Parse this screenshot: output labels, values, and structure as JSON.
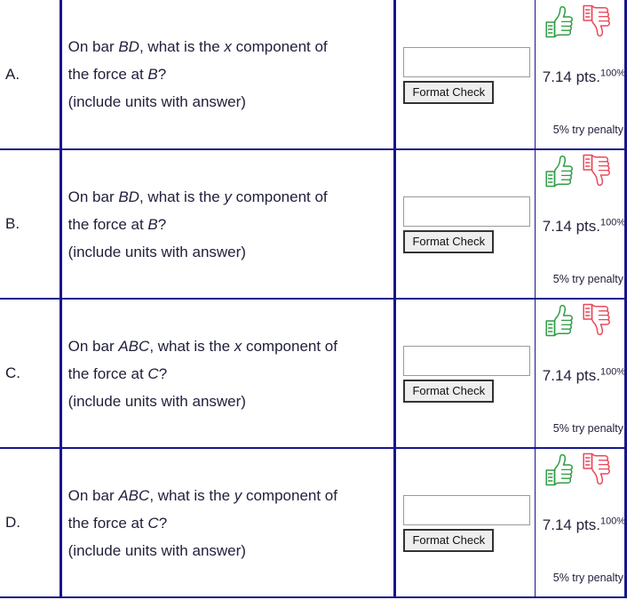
{
  "table": {
    "rows": [
      {
        "label": "A.",
        "question_line1_pre": "On bar ",
        "question_line1_em": "BD",
        "question_line1_mid": ", what is the ",
        "question_line1_var": "x",
        "question_line1_post": " component of",
        "question_line2_pre": "the force at ",
        "question_line2_em": "B",
        "question_line2_post": "?",
        "question_line3": "(include units with answer)",
        "answer_value": "",
        "answer_placeholder": "",
        "format_check_label": "Format Check",
        "points": "7.14 pts.",
        "percent": "100%",
        "penalty": "5% try penalty",
        "thumb_up_icon": "thumbs-up-icon",
        "thumb_down_icon": "thumbs-down-icon"
      },
      {
        "label": "B.",
        "question_line1_pre": "On bar ",
        "question_line1_em": "BD",
        "question_line1_mid": ", what is the ",
        "question_line1_var": "y",
        "question_line1_post": " component of",
        "question_line2_pre": "the force at ",
        "question_line2_em": "B",
        "question_line2_post": "?",
        "question_line3": "(include units with answer)",
        "answer_value": "",
        "answer_placeholder": "",
        "format_check_label": "Format Check",
        "points": "7.14 pts.",
        "percent": "100%",
        "penalty": "5% try penalty",
        "thumb_up_icon": "thumbs-up-icon",
        "thumb_down_icon": "thumbs-down-icon"
      },
      {
        "label": "C.",
        "question_line1_pre": "On bar ",
        "question_line1_em": "ABC",
        "question_line1_mid": ", what is the ",
        "question_line1_var": "x",
        "question_line1_post": " component of",
        "question_line2_pre": "the force at ",
        "question_line2_em": "C",
        "question_line2_post": "?",
        "question_line3": "(include units with answer)",
        "answer_value": "",
        "answer_placeholder": "",
        "format_check_label": "Format Check",
        "points": "7.14 pts.",
        "percent": "100%",
        "penalty": "5% try penalty",
        "thumb_up_icon": "thumbs-up-icon",
        "thumb_down_icon": "thumbs-down-icon"
      },
      {
        "label": "D.",
        "question_line1_pre": "On bar ",
        "question_line1_em": "ABC",
        "question_line1_mid": ", what is the ",
        "question_line1_var": "y",
        "question_line1_post": " component of",
        "question_line2_pre": "the force at ",
        "question_line2_em": "C",
        "question_line2_post": "?",
        "question_line3": "(include units with answer)",
        "answer_value": "",
        "answer_placeholder": "",
        "format_check_label": "Format Check",
        "points": "7.14 pts.",
        "percent": "100%",
        "penalty": "5% try penalty",
        "thumb_up_icon": "thumbs-up-icon",
        "thumb_down_icon": "thumbs-down-icon"
      }
    ]
  },
  "colors": {
    "grid_line": "#15158c",
    "text": "#22223c",
    "thumb_up": "#2f9e44",
    "thumb_down": "#e8485a",
    "button_face": "#eeeeee",
    "button_border": "#333333",
    "input_border": "#9a9a9a"
  }
}
